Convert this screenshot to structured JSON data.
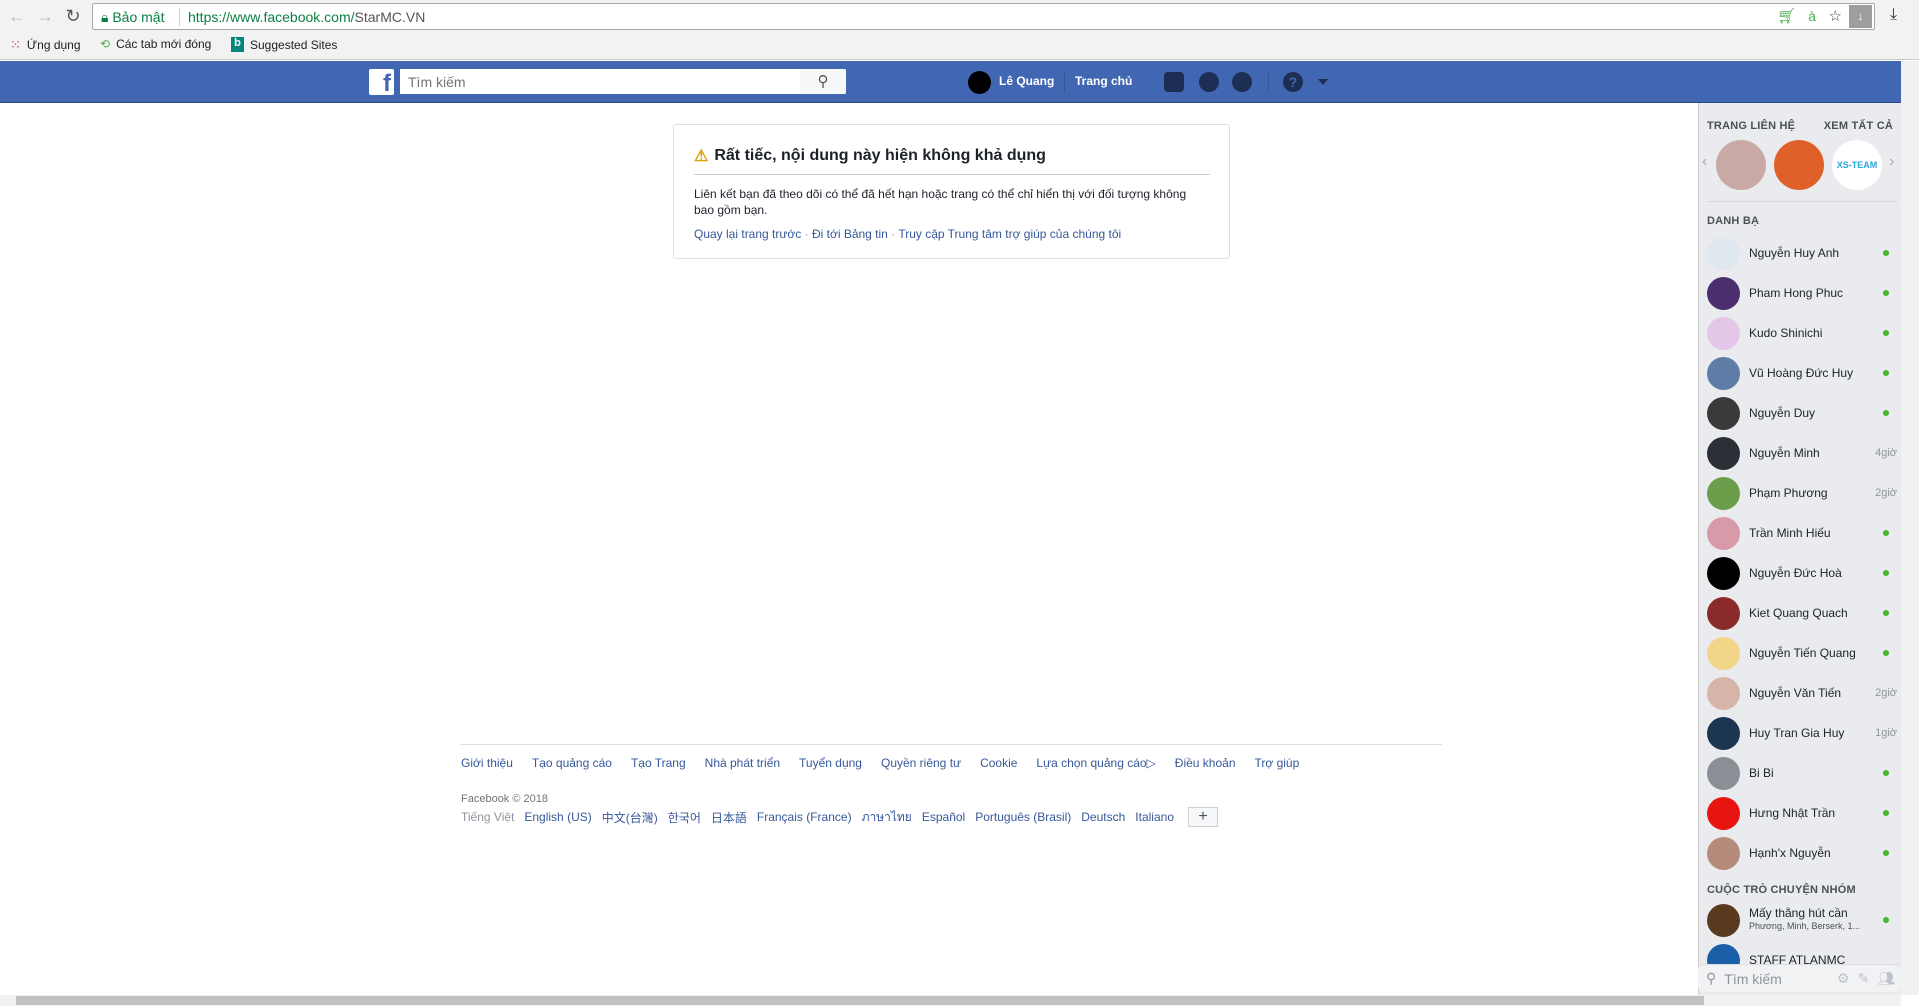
{
  "browser": {
    "secure_label": "Bảo mật",
    "url_host": "https://www.facebook.com/",
    "url_path": "StarMC.VN",
    "bookmarks": [
      {
        "label": "Ứng dụng",
        "icon": "apps-grid-icon"
      },
      {
        "label": "Các tab mới đóng",
        "icon": "history-icon"
      },
      {
        "label": "Suggested Sites",
        "icon": "bing-icon"
      }
    ],
    "ext_text": "à"
  },
  "header": {
    "search_placeholder": "Tìm kiếm",
    "user_name": "Lê Quang",
    "home_label": "Trang chủ"
  },
  "error": {
    "title": "Rất tiếc, nội dung này hiện không khả dụng",
    "body": "Liên kết bạn đã theo dõi có thể đã hết hạn hoặc trang có thể chỉ hiển thị với đối tượng không bao gồm bạn.",
    "links": [
      "Quay lại trang trước",
      "Đi tới Bảng tin",
      "Truy cập Trung tâm trợ giúp của chúng tôi"
    ],
    "sep": " · "
  },
  "footer": {
    "links": [
      "Giới thiệu",
      "Tạo quảng cáo",
      "Tạo Trang",
      "Nhà phát triển",
      "Tuyển dụng",
      "Quyền riêng tư",
      "Cookie",
      "Lựa chọn quảng cáo",
      "Điều khoản",
      "Trợ giúp"
    ],
    "copyright": "Facebook © 2018",
    "current_language": "Tiếng Việt",
    "languages": [
      "English (US)",
      "中文(台灣)",
      "한국어",
      "日本語",
      "Français (France)",
      "ภาษาไทย",
      "Español",
      "Português (Brasil)",
      "Deutsch",
      "Italiano"
    ],
    "more": "+"
  },
  "sidebar": {
    "pages_title": "TRANG LIÊN HỆ",
    "see_all": "XEM TẤT CẢ",
    "contacts_title": "DANH BẠ",
    "contacts": [
      {
        "name": "Nguyễn Huy Anh",
        "status": "online",
        "color": "#dfe8ee"
      },
      {
        "name": "Pham Hong Phuc",
        "status": "online",
        "color": "#4a2e6e"
      },
      {
        "name": "Kudo Shinichi",
        "status": "online",
        "color": "#e3c6e8"
      },
      {
        "name": "Vũ Hoàng Đức Huy",
        "status": "online",
        "color": "#5d7da6"
      },
      {
        "name": "Nguyễn Duy",
        "status": "online",
        "color": "#3a3a3a"
      },
      {
        "name": "Nguyễn Minh",
        "status": "4giờ",
        "color": "#2b2f36"
      },
      {
        "name": "Phạm Phương",
        "status": "2giờ",
        "color": "#6b9e4b"
      },
      {
        "name": "Trần Minh Hiếu",
        "status": "online",
        "color": "#d89aa8"
      },
      {
        "name": "Nguyễn Đức Hoà",
        "status": "online",
        "color": "#000000"
      },
      {
        "name": "Kiet Quang Quach",
        "status": "online",
        "color": "#8a2a2a"
      },
      {
        "name": "Nguyễn Tiến Quang",
        "status": "online",
        "color": "#f3d58a"
      },
      {
        "name": "Nguyễn Văn Tiến",
        "status": "2giờ",
        "color": "#d7b4a8"
      },
      {
        "name": "Huy Tran Gia Huy",
        "status": "1giờ",
        "color": "#1c3550"
      },
      {
        "name": "Bi Bi",
        "status": "online",
        "color": "#8a8f96"
      },
      {
        "name": "Hưng Nhật Trần",
        "status": "online",
        "color": "#e8140f"
      },
      {
        "name": "Hạnh'x Nguyễn",
        "status": "online",
        "color": "#b58b7c"
      }
    ],
    "groups_title": "CUỘC TRÒ CHUYỆN NHÓM",
    "groups": [
      {
        "name": "Mấy thằng hút cần",
        "members": "Phương, Minh, Berserk, 1...",
        "status": "online",
        "color": "#5a3a1e"
      },
      {
        "name": "STAFF ATLANMC",
        "color": "#1b5fa8"
      }
    ],
    "search_placeholder": "Tìm kiếm"
  },
  "colors": {
    "brand": "#4267b2",
    "online": "#42b72a",
    "link": "#365899"
  }
}
